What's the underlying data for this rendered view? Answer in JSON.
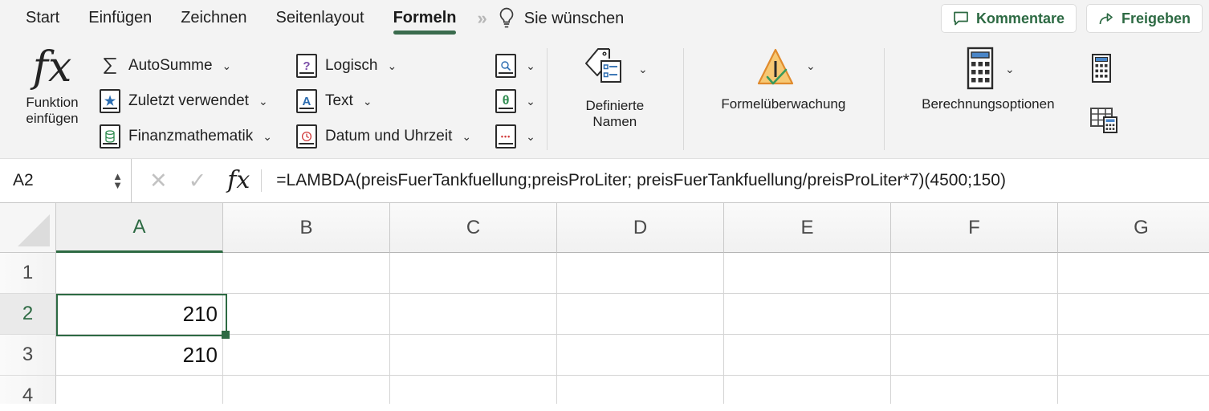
{
  "app": {
    "accent_green": "#2d6a43",
    "ribbon_bg": "#f3f3f3"
  },
  "tabs": {
    "items": [
      {
        "label": "Start",
        "active": false
      },
      {
        "label": "Einfügen",
        "active": false
      },
      {
        "label": "Zeichnen",
        "active": false
      },
      {
        "label": "Seitenlayout",
        "active": false
      },
      {
        "label": "Formeln",
        "active": true
      }
    ],
    "overflow_chevrons": "»",
    "tell_me": "Sie wünschen",
    "tell_me_icon": "lightbulb-icon",
    "comments_button": "Kommentare",
    "share_button": "Freigeben"
  },
  "ribbon": {
    "insert_function": {
      "label_line1": "Funktion",
      "label_line2": "einfügen",
      "icon": "fx-icon"
    },
    "function_library": [
      {
        "label": "AutoSumme",
        "icon": "sigma-icon",
        "caret": "⌄"
      },
      {
        "label": "Zuletzt verwendet",
        "icon": "recent-star-book-icon",
        "caret": "⌄"
      },
      {
        "label": "Finanzmathematik",
        "icon": "financial-book-icon",
        "caret": "⌄"
      }
    ],
    "function_library_2": [
      {
        "label": "Logisch",
        "icon": "logical-book-icon",
        "glyph": "?",
        "color": "#7b4fa8",
        "caret": "⌄"
      },
      {
        "label": "Text",
        "icon": "text-book-icon",
        "glyph": "A",
        "color": "#2b6cb0",
        "caret": "⌄"
      },
      {
        "label": "Datum und Uhrzeit",
        "icon": "datetime-book-icon",
        "glyph": "◷",
        "color": "#d13b3b",
        "caret": "⌄"
      }
    ],
    "function_library_icons": [
      {
        "name": "lookup-reference-icon",
        "glyph": "⌕",
        "color": "#2b6cb0",
        "caret": "⌄"
      },
      {
        "name": "math-trig-icon",
        "glyph": "θ",
        "color": "#2e8b4f",
        "caret": "⌄"
      },
      {
        "name": "more-functions-icon",
        "glyph": "•••",
        "color": "#d13b3b",
        "caret": "⌄"
      }
    ],
    "defined_names": {
      "label_line1": "Definierte",
      "label_line2": "Namen",
      "icon": "name-tag-icon",
      "caret": "⌄"
    },
    "formula_auditing": {
      "label": "Formelüberwachung",
      "icon": "error-check-triangle-icon",
      "caret": "⌄"
    },
    "calculation_options": {
      "label": "Berechnungsoptionen",
      "icon": "calculator-icon",
      "caret": "⌄"
    },
    "calc_now": {
      "name": "calculate-now-icon"
    },
    "calc_sheet": {
      "name": "calculate-sheet-icon"
    }
  },
  "formula_bar": {
    "name_box_value": "A2",
    "cancel_icon": "cancel-x-icon",
    "accept_icon": "accept-check-icon",
    "fx_icon": "fx-icon",
    "formula": "=LAMBDA(preisFuerTankfuellung;preisProLiter; preisFuerTankfuellung/preisProLiter*7)(4500;150)"
  },
  "sheet": {
    "columns": [
      "A",
      "B",
      "C",
      "D",
      "E",
      "F",
      "G"
    ],
    "selected_column": "A",
    "selected_row": "2",
    "active_cell": "A2",
    "rows": [
      {
        "header": "1",
        "cells": [
          "",
          "",
          "",
          "",
          "",
          "",
          ""
        ]
      },
      {
        "header": "2",
        "cells": [
          "210",
          "",
          "",
          "",
          "",
          "",
          ""
        ]
      },
      {
        "header": "3",
        "cells": [
          "210",
          "",
          "",
          "",
          "",
          "",
          ""
        ]
      },
      {
        "header": "4",
        "cells": [
          "",
          "",
          "",
          "",
          "",
          "",
          ""
        ]
      }
    ]
  }
}
